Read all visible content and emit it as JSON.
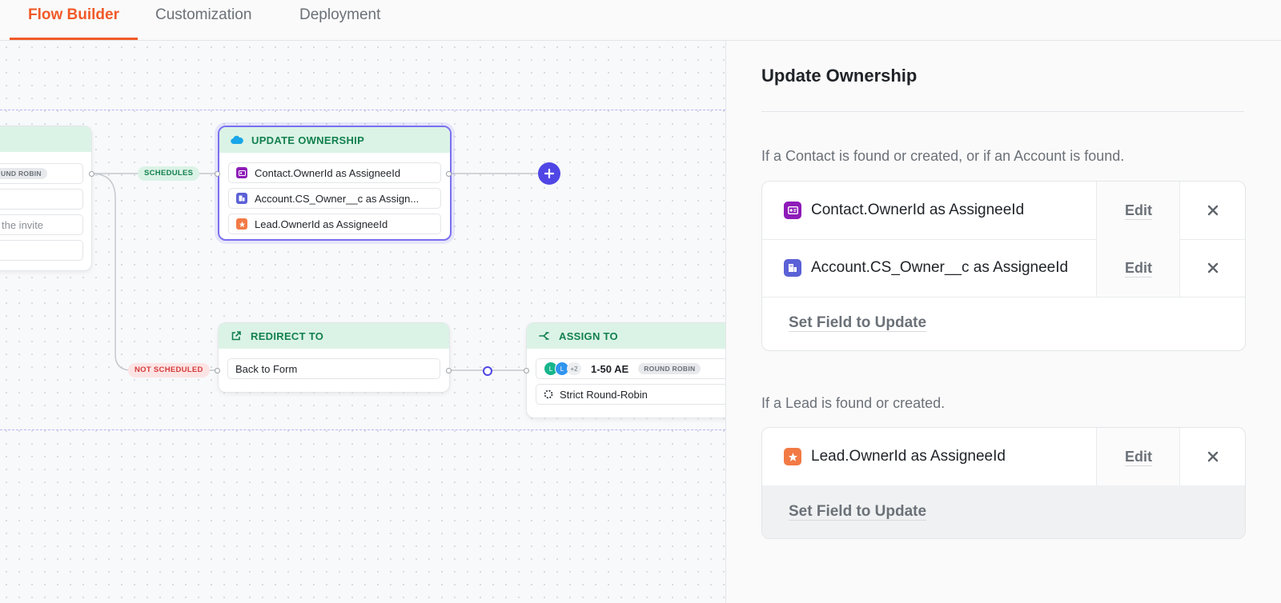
{
  "tabs": [
    {
      "label": "Flow Builder",
      "active": true
    },
    {
      "label": "Customization",
      "active": false
    },
    {
      "label": "Deployment",
      "active": false
    }
  ],
  "colors": {
    "accent": "#f05a28",
    "node_header_bg": "#dbf3e6",
    "node_header_text": "#13804f",
    "selection": "#7b6ff0",
    "add_button": "#4f46e5"
  },
  "canvas": {
    "left_node": {
      "rows": [
        "UND ROBIN",
        "",
        "the invite",
        ""
      ]
    },
    "pills": {
      "scheduled": "SCHEDULES",
      "not_scheduled": "NOT SCHEDULED"
    },
    "update_node": {
      "title": "UPDATE OWNERSHIP",
      "rows": [
        "Contact.OwnerId as AssigneeId",
        "Account.CS_Owner__c as Assign...",
        "Lead.OwnerId as AssigneeId"
      ]
    },
    "redirect_node": {
      "title": "REDIRECT TO",
      "row": "Back to Form"
    },
    "assign_node": {
      "title": "ASSIGN TO",
      "avatars": [
        "L",
        "L"
      ],
      "extra": "+2",
      "team": "1-50 AE",
      "chip": "ROUND ROBIN",
      "method": "Strict Round-Robin"
    },
    "add_button_icon": "plus-icon"
  },
  "panel": {
    "title": "Update Ownership",
    "section1": {
      "label": "If a Contact is found or created, or if an Account is found.",
      "fields": [
        {
          "text": "Contact.OwnerId as AssigneeId",
          "edit": "Edit",
          "icon": "contact-card-icon",
          "color": "#8e1bb8"
        },
        {
          "text": "Account.CS_Owner__c as AssigneeId",
          "edit": "Edit",
          "icon": "building-icon",
          "color": "#5b61d6"
        }
      ],
      "set_field": "Set Field to Update"
    },
    "section2": {
      "label": "If a Lead is found or created.",
      "fields": [
        {
          "text": "Lead.OwnerId as AssigneeId",
          "edit": "Edit",
          "icon": "lead-star-icon",
          "color": "#f27a45"
        }
      ],
      "set_field": "Set Field to Update"
    }
  }
}
